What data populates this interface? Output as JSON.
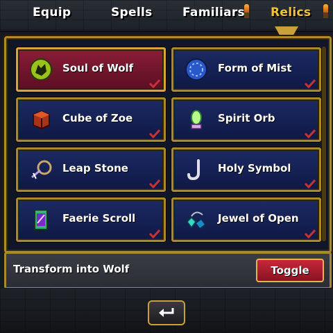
{
  "tabs": [
    {
      "label": "Equip",
      "active": false
    },
    {
      "label": "Spells",
      "active": false
    },
    {
      "label": "Familiars",
      "active": false
    },
    {
      "label": "Relics",
      "active": true
    }
  ],
  "relics": [
    {
      "label": "Soul of Wolf",
      "icon": "wolf-head-icon",
      "selected": true,
      "equipped": true
    },
    {
      "label": "Form of Mist",
      "icon": "mist-orb-icon",
      "selected": false,
      "equipped": true
    },
    {
      "label": "Cube of Zoe",
      "icon": "cube-icon",
      "selected": false,
      "equipped": true
    },
    {
      "label": "Spirit Orb",
      "icon": "spirit-orb-icon",
      "selected": false,
      "equipped": true
    },
    {
      "label": "Leap Stone",
      "icon": "leap-stone-icon",
      "selected": false,
      "equipped": true
    },
    {
      "label": "Holy Symbol",
      "icon": "hook-icon",
      "selected": false,
      "equipped": true
    },
    {
      "label": "Faerie Scroll",
      "icon": "scroll-icon",
      "selected": false,
      "equipped": true
    },
    {
      "label": "Jewel of Open",
      "icon": "jewel-icon",
      "selected": false,
      "equipped": true
    }
  ],
  "description": {
    "text": "Transform into Wolf",
    "button_label": "Toggle"
  },
  "colors": {
    "active_tab": "#f4c23a",
    "slot_bg": "#1c2a62",
    "selected_slot_bg": "#8a1e36",
    "gold_border": "#a8892c",
    "toggle_red": "#c6283a"
  }
}
